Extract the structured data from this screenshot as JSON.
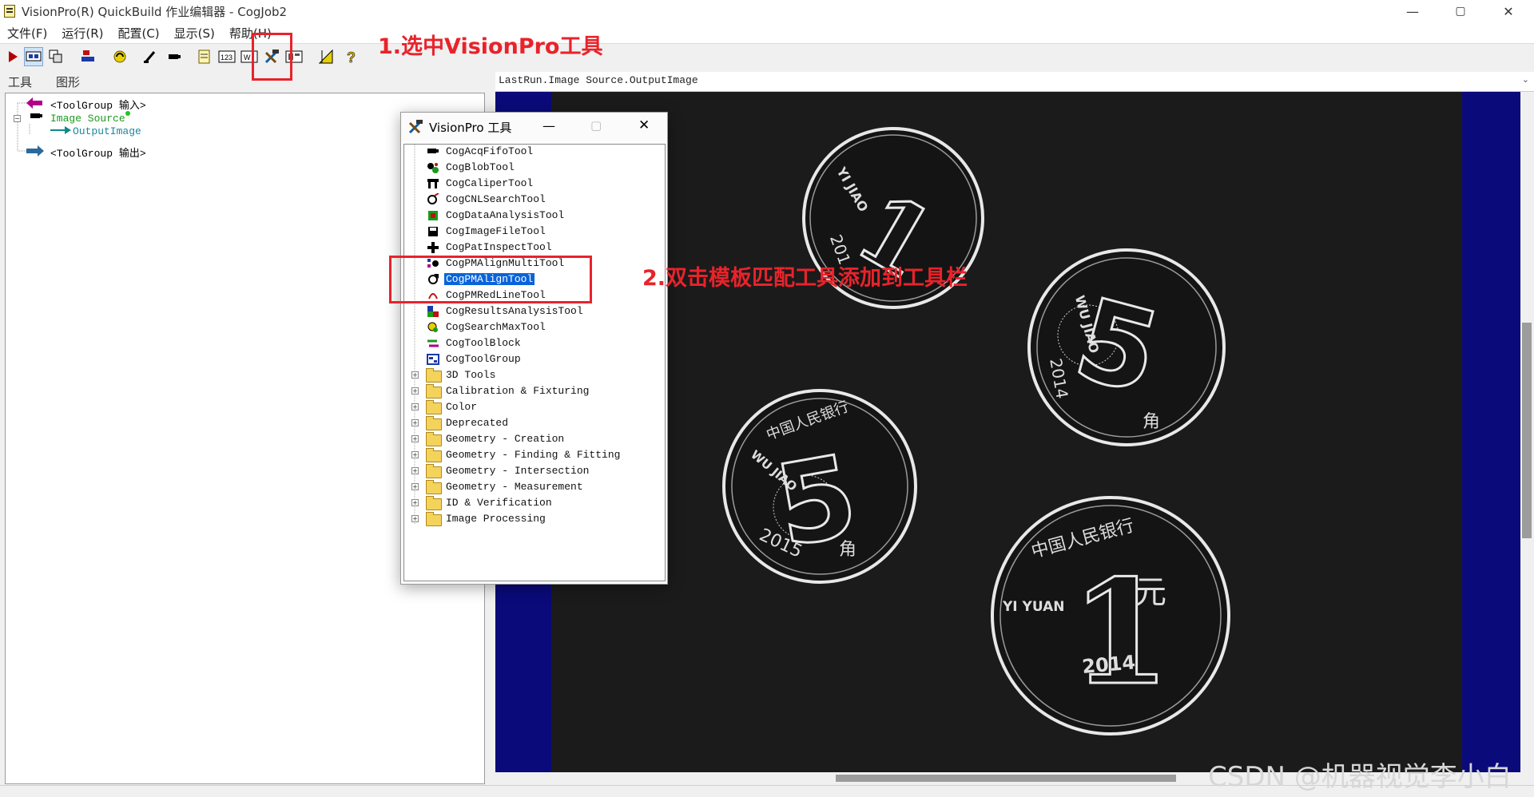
{
  "window": {
    "title": "VisionPro(R) QuickBuild 作业编辑器 - CogJob2",
    "minimize": "—",
    "maximize": "▢",
    "close": "✕"
  },
  "menu": [
    "文件(F)",
    "运行(R)",
    "配置(C)",
    "显示(S)",
    "帮助(H)"
  ],
  "left_tabs": [
    "工具",
    "图形"
  ],
  "tree": {
    "input_group": "<ToolGroup 输入>",
    "image_source": "Image Source",
    "output_image": "OutputImage",
    "output_group": "<ToolGroup 输出>"
  },
  "image_header": "LastRun.Image Source.OutputImage",
  "dialog": {
    "title": "VisionPro 工具",
    "tools": [
      "CogAcqFifoTool",
      "CogBlobTool",
      "CogCaliperTool",
      "CogCNLSearchTool",
      "CogDataAnalysisTool",
      "CogImageFileTool",
      "CogPatInspectTool",
      "CogPMAlignMultiTool",
      "CogPMAlignTool",
      "CogPMRedLineTool",
      "CogResultsAnalysisTool",
      "CogSearchMaxTool",
      "CogToolBlock",
      "CogToolGroup"
    ],
    "selected_tool": "CogPMAlignTool",
    "folders": [
      "3D Tools",
      "Calibration & Fixturing",
      "Color",
      "Deprecated",
      "Geometry - Creation",
      "Geometry - Finding & Fitting",
      "Geometry - Intersection",
      "Geometry - Measurement",
      "ID & Verification",
      "Image Processing"
    ]
  },
  "annotations": {
    "step1": "1.选中VisionPro工具",
    "step2": "2.双击模板匹配工具添加到工具栏"
  },
  "coins": {
    "coin_1jiao_a": {
      "pinyin": "YI JIAO",
      "value": "1",
      "year": "201"
    },
    "coin_5jiao_a": {
      "pinyin": "WU JIAO",
      "value": "5",
      "year": "2014",
      "char": "角"
    },
    "coin_5jiao_b": {
      "pinyin": "WU JIAO",
      "value": "5",
      "year": "2015",
      "char": "角"
    },
    "coin_1yuan": {
      "pinyin": "YI YUAN",
      "value": "1",
      "year": "2014",
      "char": "元"
    },
    "rim_text": "中国人民银行"
  },
  "watermark": "CSDN @机器视觉李小白",
  "colors": {
    "annotation_red": "#e8232b",
    "selection_blue": "#0a64d9",
    "view_bg": "#0a0a7a"
  }
}
